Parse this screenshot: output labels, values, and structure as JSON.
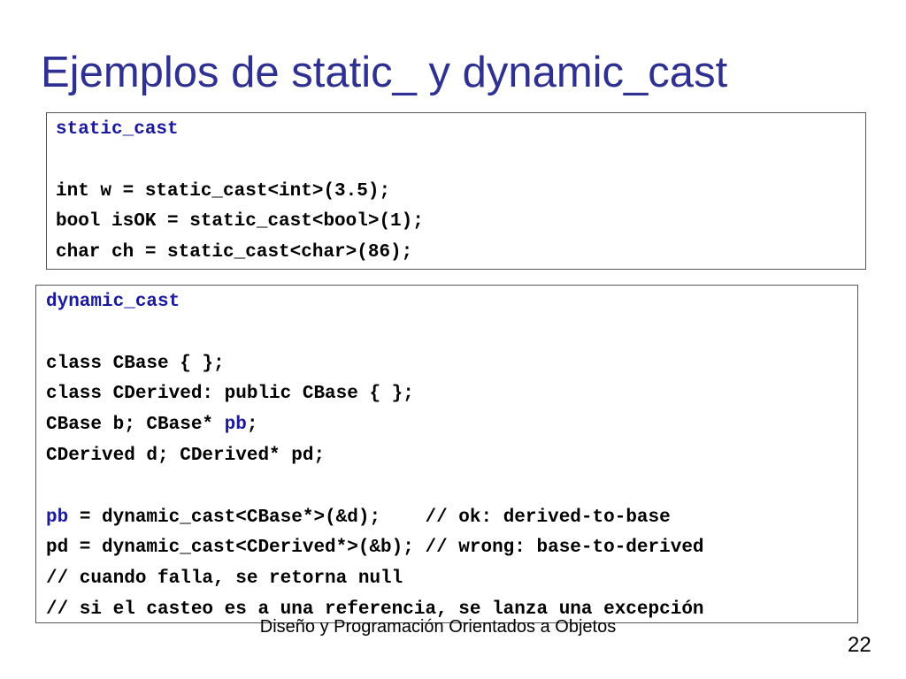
{
  "slide": {
    "title": "Ejemplos de static_ y dynamic_cast",
    "title_color": "#2e3192",
    "keyword_color": "#1a1a9e"
  },
  "static_box": {
    "heading": "static_cast",
    "line1": "int w = static_cast<int>(3.5);",
    "line2": "bool isOK = static_cast<bool>(1);",
    "line3": "char ch = static_cast<char>(86);"
  },
  "dynamic_box": {
    "heading": "dynamic_cast",
    "line1": "class CBase { };",
    "line2": "class CDerived: public CBase { };",
    "line3_a": "CBase b; CBase* ",
    "line3_pb": "pb",
    "line3_b": ";",
    "line4": "CDerived d; CDerived* pd;",
    "line5_pb": "pb",
    "line5_rest": " = dynamic_cast<CBase*>(&d);    // ok: derived-to-base",
    "line6": "pd = dynamic_cast<CDerived*>(&b); // wrong: base-to-derived",
    "line7": "// cuando falla, se retorna null",
    "line8": "// si el casteo es a una referencia, se lanza una excepción"
  },
  "footer": {
    "text": "Diseño y Programación Orientados a Objetos",
    "page_number": "22"
  }
}
